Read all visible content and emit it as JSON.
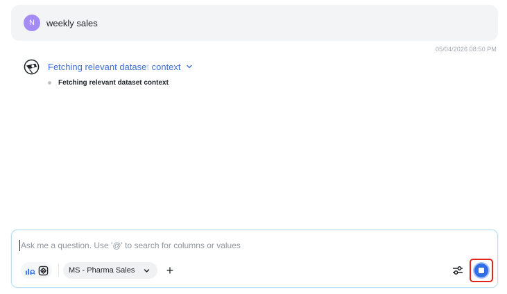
{
  "user_message": {
    "avatar_initial": "N",
    "text": "weekly sales"
  },
  "timestamp": "05/04/2026 08:50 PM",
  "agent": {
    "status_text_a": "Fetching relevant datase",
    "status_text_b": "t ",
    "status_text_c": "context",
    "step_text": "Fetching relevant dataset context"
  },
  "composer": {
    "placeholder": "Ask me a question. Use '@' to search for columns or values",
    "value": "",
    "dataset_selected": "MS - Pharma Sales",
    "add_label": "+"
  },
  "colors": {
    "accent": "#2f6ee6",
    "avatar": "#a58cf5",
    "status_link": "#3b6fd6",
    "highlight": "#e0261b"
  },
  "icons": {
    "agent": "agent-logo-icon",
    "status_chevron": "chevron-down-icon",
    "analysis": "chart-search-icon",
    "feature": "sparkle-grid-icon",
    "dataset_chevron": "chevron-down-icon",
    "add": "plus-icon",
    "settings": "sliders-icon",
    "stop": "stop-icon"
  }
}
